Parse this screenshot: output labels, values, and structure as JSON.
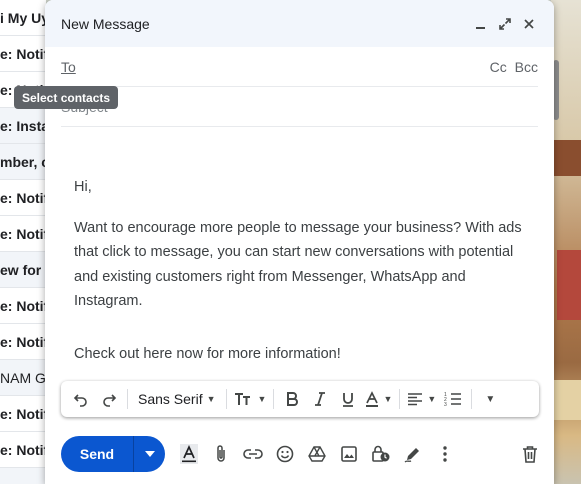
{
  "background_list": {
    "rows": [
      {
        "text": "i My Uy",
        "unread": true
      },
      {
        "text": "e: Notif",
        "unread": true
      },
      {
        "text": "e: Notif",
        "unread": true
      },
      {
        "text": "e: Insta",
        "unread": false
      },
      {
        "text": "mber, cl",
        "unread": false
      },
      {
        "text": "e: Notif",
        "unread": true
      },
      {
        "text": "e: Notif",
        "unread": true
      },
      {
        "text": "ew for v",
        "unread": false
      },
      {
        "text": "e: Notif",
        "unread": true
      },
      {
        "text": "e: Notif",
        "unread": true
      },
      {
        "text": "NAM GIA",
        "unread": false
      },
      {
        "text": "e: Notif",
        "unread": true
      },
      {
        "text": "e: Notif",
        "unread": true
      }
    ]
  },
  "compose": {
    "title": "New Message",
    "to_label": "To",
    "cc_label": "Cc",
    "bcc_label": "Bcc",
    "subject_placeholder": "Subject",
    "tooltip": "Select contacts",
    "body": {
      "greeting": "Hi,",
      "paragraph1": "Want to encourage more people to message your business? With ads that click to message, you can start new conversations with potential and existing customers right from Messenger, WhatsApp and Instagram.",
      "paragraph2": "Check out here now for more information!"
    },
    "toolbar": {
      "font": "Sans Serif"
    },
    "send_label": "Send"
  },
  "colors": {
    "accent": "#0b57d0",
    "header_bg": "#f2f6fc",
    "tooltip_bg": "#5f6368"
  },
  "icons": {
    "header": [
      "minimize-icon",
      "fullscreen-icon",
      "close-icon"
    ],
    "format": [
      "undo-icon",
      "redo-icon",
      "text-size-icon",
      "bold-icon",
      "italic-icon",
      "underline-icon",
      "text-color-icon",
      "align-icon",
      "numbered-list-icon",
      "more-formatting-icon"
    ],
    "actions": [
      "formatting-options-icon",
      "attach-icon",
      "link-icon",
      "emoji-icon",
      "drive-icon",
      "photo-icon",
      "confidential-icon",
      "signature-icon",
      "more-options-icon",
      "discard-icon"
    ]
  }
}
